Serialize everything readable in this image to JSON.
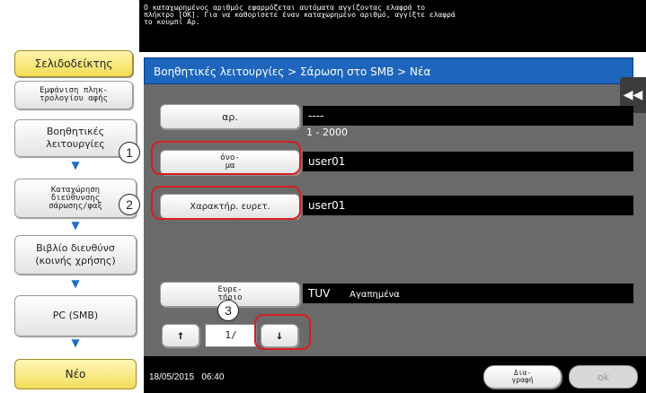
{
  "message": "Ο καταχωρημένος αριθμός εφαρμόζεται αυτόματα αγγίζοντας ελαφρά το\nπλήκτρο [OK]. Για να καθορίσετε έναν καταχωρημένο αριθμό, αγγίξτε ελαφρά\nτο κουμπί Αρ.",
  "sidebar": {
    "bookmark_tab": "Σελιδοδείκτης",
    "list_display": "Εμφάνιση πληκ-\nτρολογίου αφής",
    "flow": [
      "Βοηθητικές\nλειτουργίες",
      "Καταχώρηση\nδιεύθυνσης\nσάρωσης/φαξ",
      "Βιβλίο διευθύνσ\n(κοινής χρήσης)",
      "PC (SMB)"
    ],
    "new_button": "Νέο"
  },
  "breadcrumb": "Βοηθητικές λειτουργίες > Σάρωση στο SMB > Νέα",
  "fields": {
    "number_label": "αρ.",
    "number_value": "----",
    "number_range": "1 - 2000",
    "name_label": "όνο-\nμα",
    "name_value": "user01",
    "index_label": "Χαρακτήρ. ευρετ.",
    "index_value": "user01",
    "index_short_label": "Ευρε-\nτήριο",
    "index_short_value": "TUV",
    "favorites": "Αγαπημένα"
  },
  "pager": {
    "up": "↑",
    "page": "1/",
    "down": "↓"
  },
  "callouts": [
    "1",
    "2",
    "3"
  ],
  "footer": {
    "datetime": "18/05/2015   06:40",
    "delete_label": "Δια-\nγραφή",
    "ok_label": "ok"
  },
  "colors": {
    "accent_blue": "#1e65bd",
    "highlight_yellow": "#f3dd5a",
    "callout_red": "#d42020"
  }
}
